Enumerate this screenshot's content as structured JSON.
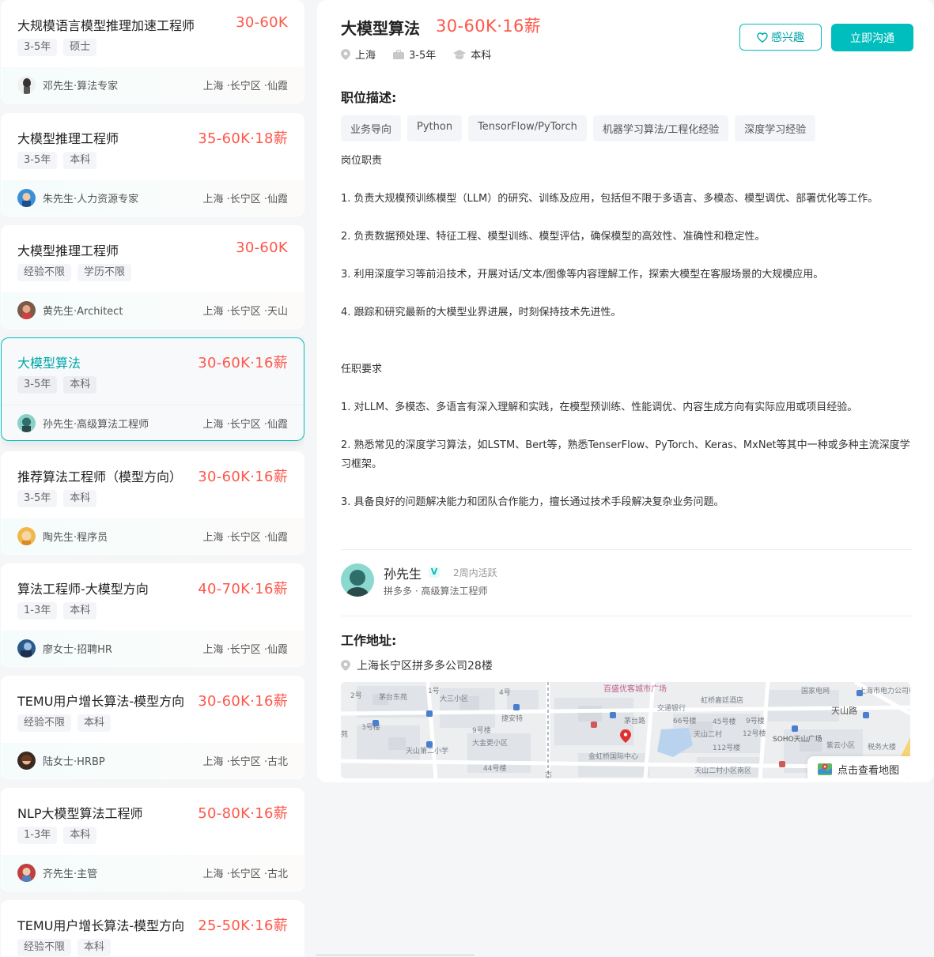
{
  "jobs": [
    {
      "title": "大规模语言模型推理加速工程师",
      "salary": "30-60K",
      "tags": [
        "3-5年",
        "硕士"
      ],
      "boss": "邓先生·算法专家",
      "location": "上海 ·长宁区 ·仙霞"
    },
    {
      "title": "大模型推理工程师",
      "salary": "35-60K·18薪",
      "tags": [
        "3-5年",
        "本科"
      ],
      "boss": "朱先生·人力资源专家",
      "location": "上海 ·长宁区 ·仙霞"
    },
    {
      "title": "大模型推理工程师",
      "salary": "30-60K",
      "tags": [
        "经验不限",
        "学历不限"
      ],
      "boss": "黄先生·Architect",
      "location": "上海 ·长宁区 ·天山"
    },
    {
      "title": "大模型算法",
      "salary": "30-60K·16薪",
      "tags": [
        "3-5年",
        "本科"
      ],
      "boss": "孙先生·高级算法工程师",
      "location": "上海 ·长宁区 ·仙霞"
    },
    {
      "title": "推荐算法工程师（模型方向）",
      "salary": "30-60K·16薪",
      "tags": [
        "3-5年",
        "本科"
      ],
      "boss": "陶先生·程序员",
      "location": "上海 ·长宁区 ·仙霞"
    },
    {
      "title": "算法工程师-大模型方向",
      "salary": "40-70K·16薪",
      "tags": [
        "1-3年",
        "本科"
      ],
      "boss": "廖女士·招聘HR",
      "location": "上海 ·长宁区 ·仙霞"
    },
    {
      "title": "TEMU用户增长算法-模型方向",
      "salary": "30-60K·16薪",
      "tags": [
        "经验不限",
        "本科"
      ],
      "boss": "陆女士·HRBP",
      "location": "上海 ·长宁区 ·古北"
    },
    {
      "title": "NLP大模型算法工程师",
      "salary": "50-80K·16薪",
      "tags": [
        "1-3年",
        "本科"
      ],
      "boss": "齐先生·主管",
      "location": "上海 ·长宁区 ·古北"
    },
    {
      "title": "TEMU用户增长算法-模型方向",
      "salary": "25-50K·16薪",
      "tags": [
        "经验不限",
        "本科"
      ],
      "boss": "",
      "location": ""
    }
  ],
  "detail": {
    "title": "大模型算法",
    "salary": "30-60K·16薪",
    "city": "上海",
    "experience": "3-5年",
    "degree": "本科",
    "interest_label": "感兴趣",
    "chat_label": "立即沟通",
    "desc_title": "职位描述:",
    "skills": [
      "业务导向",
      "Python",
      "TensorFlow/PyTorch",
      "机器学习算法/工程化经验",
      "深度学习经验"
    ],
    "desc_lines": [
      "岗位职责",
      "",
      "1. 负责大规模预训练模型（LLM）的研究、训练及应用，包括但不限于多语言、多模态、模型调优、部署优化等工作。",
      "",
      "2. 负责数据预处理、特征工程、模型训练、模型评估，确保模型的高效性、准确性和稳定性。",
      "",
      "3. 利用深度学习等前沿技术，开展对话/文本/图像等内容理解工作，探索大模型在客服场景的大规模应用。",
      "",
      "4. 跟踪和研究最新的大模型业界进展，时刻保持技术先进性。",
      "",
      "",
      "任职要求",
      "",
      "1. 对LLM、多模态、多语言有深入理解和实践，在模型预训练、性能调优、内容生成方向有实际应用或项目经验。",
      "",
      "2. 熟悉常见的深度学习算法，如LSTM、Bert等，熟悉TenserFlow、PyTorch、Keras、MxNet等其中一种或多种主流深度学习框架。",
      "",
      "3. 具备良好的问题解决能力和团队合作能力，擅长通过技术手段解决复杂业务问题。"
    ],
    "boss_name": "孙先生",
    "boss_active": "2周内活跃",
    "boss_sub": "拼多多 · 高级算法工程师",
    "address_title": "工作地址:",
    "address": "上海长宁区拼多多公司28楼",
    "map_button": "点击查看地图",
    "map_labels": [
      "百盛优客城市广场",
      "上海市电力公司电力科学研究院",
      "国家电网",
      "天山路",
      "茅台东苑",
      "大三小区",
      "2号",
      "1号",
      "4号",
      "交通银行",
      "虹桥嘉廷酒店",
      "捷安特",
      "茅台路",
      "66号楼",
      "45号楼",
      "9号楼",
      "天山二村",
      "12号楼",
      "SOHO天山广场",
      "紫云小区",
      "税务大楼",
      "9号楼",
      "3号楼",
      "苑",
      "大金更小区",
      "天山第二小学",
      "金虹桥国际中心",
      "112号楼",
      "44号楼",
      "天山二村小区南区",
      "古"
    ]
  }
}
